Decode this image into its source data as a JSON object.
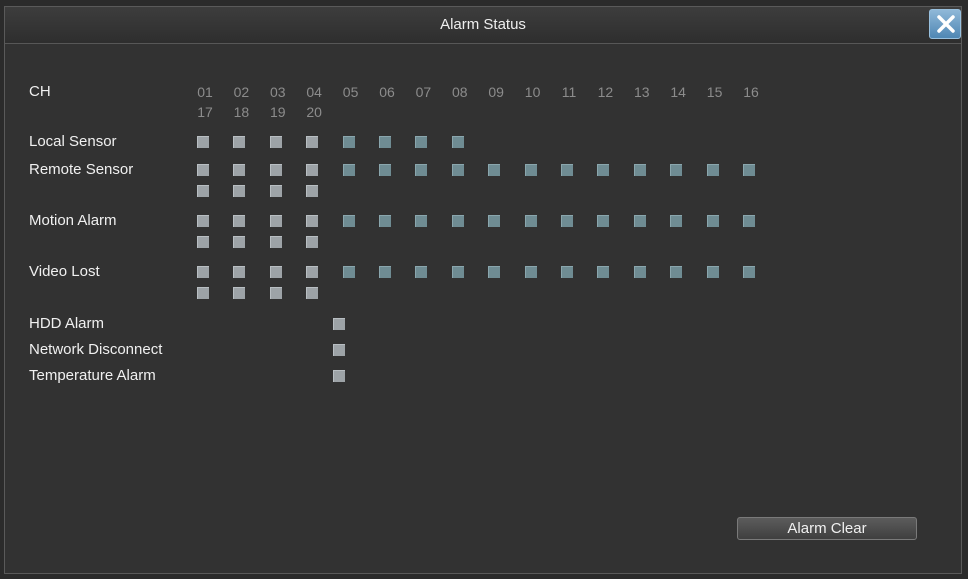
{
  "window": {
    "title": "Alarm Status"
  },
  "channels": {
    "label": "CH",
    "row1": [
      "01",
      "02",
      "03",
      "04",
      "05",
      "06",
      "07",
      "08",
      "09",
      "10",
      "11",
      "12",
      "13",
      "14",
      "15",
      "16"
    ],
    "row2": [
      "17",
      "18",
      "19",
      "20"
    ]
  },
  "rows": [
    {
      "id": "local-sensor",
      "label": "Local Sensor",
      "count": 8
    },
    {
      "id": "remote-sensor",
      "label": "Remote Sensor",
      "count": 20
    },
    {
      "id": "motion-alarm",
      "label": "Motion Alarm",
      "count": 20
    },
    {
      "id": "video-lost",
      "label": "Video Lost",
      "count": 20
    }
  ],
  "system_rows": [
    {
      "id": "hdd-alarm",
      "label": "HDD Alarm"
    },
    {
      "id": "network-disconnect",
      "label": "Network Disconnect"
    },
    {
      "id": "temperature-alarm",
      "label": "Temperature Alarm"
    }
  ],
  "buttons": {
    "alarm_clear": "Alarm Clear"
  },
  "colors": {
    "indicator": "#9da3a7",
    "indicator_alt": "#6f8c93",
    "close_button": "#4f87b4"
  }
}
